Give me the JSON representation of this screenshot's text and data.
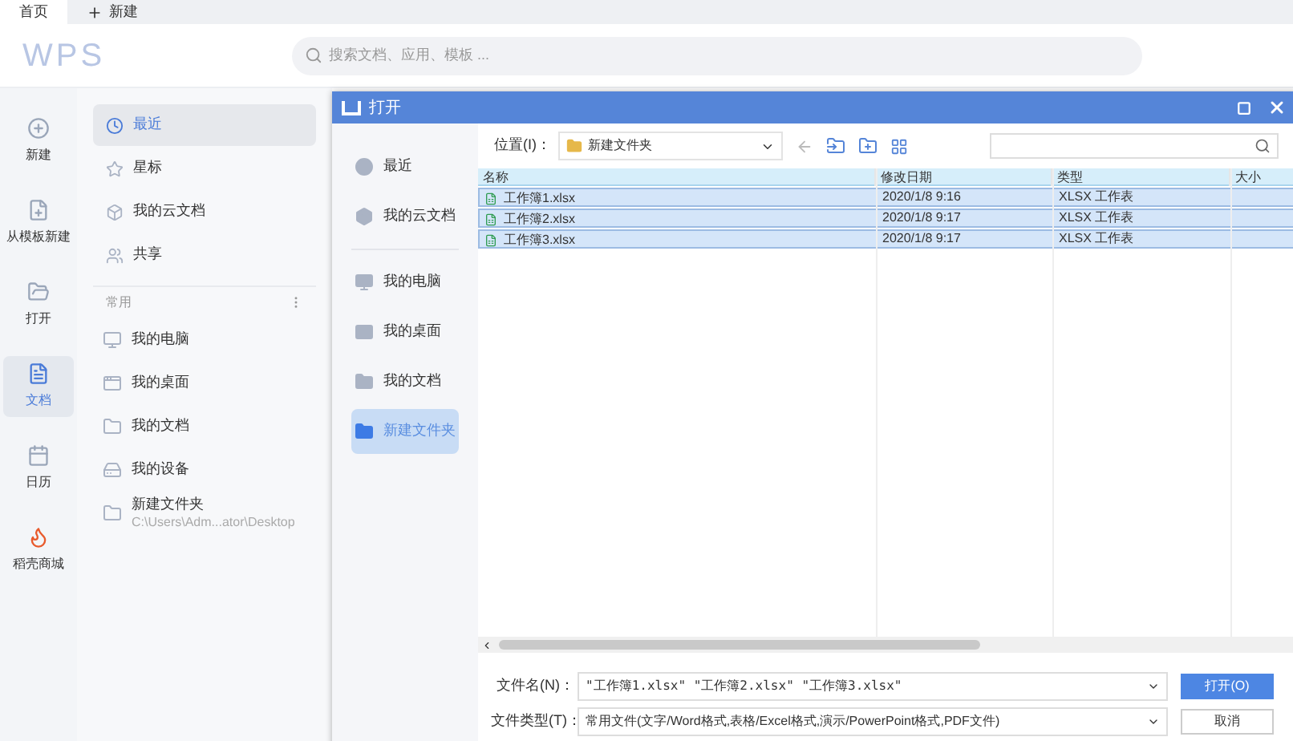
{
  "tabs": [
    {
      "label": "首页",
      "kind": "home",
      "selected": true
    },
    {
      "label": "新建",
      "kind": "new",
      "selected": false
    }
  ],
  "header": {
    "logo": "WPS",
    "search": {
      "placeholder": "搜索文档、应用、模板 ..."
    }
  },
  "rail": [
    {
      "label": "新建",
      "kind": "new",
      "selected": false
    },
    {
      "label": "从模板新建",
      "kind": "template",
      "selected": false
    },
    {
      "label": "打开",
      "kind": "open",
      "selected": false
    },
    {
      "label": "文档",
      "kind": "docs",
      "selected": true
    },
    {
      "label": "日历",
      "kind": "calendar",
      "selected": false
    },
    {
      "label": "稻壳商城",
      "kind": "store",
      "selected": false
    }
  ],
  "nav": {
    "items": [
      {
        "label": "最近",
        "kind": "recent",
        "selected": true
      },
      {
        "label": "星标",
        "kind": "star",
        "selected": false
      },
      {
        "label": "我的云文档",
        "kind": "cloud",
        "selected": false
      },
      {
        "label": "共享",
        "kind": "share",
        "selected": false
      }
    ],
    "section": "常用",
    "places": [
      {
        "label": "我的电脑",
        "kind": "pc"
      },
      {
        "label": "我的桌面",
        "kind": "desktop"
      },
      {
        "label": "我的文档",
        "kind": "folder"
      },
      {
        "label": "我的设备",
        "kind": "device"
      },
      {
        "label": "新建文件夹",
        "kind": "folder",
        "path": "C:\\Users\\Adm...ator\\Desktop"
      }
    ]
  },
  "dialog": {
    "title": "打开",
    "nav": [
      {
        "label": "最近",
        "kind": "recent",
        "selected": false
      },
      {
        "label": "我的云文档",
        "kind": "cloud",
        "selected": false
      },
      {
        "label": "我的电脑",
        "kind": "pc",
        "selected": false
      },
      {
        "label": "我的桌面",
        "kind": "desktop",
        "selected": false
      },
      {
        "label": "我的文档",
        "kind": "folder",
        "selected": false
      },
      {
        "label": "新建文件夹",
        "kind": "folder",
        "selected": true
      }
    ],
    "location_label": "位置(I)：",
    "location": "新建文件夹",
    "columns": [
      "名称",
      "修改日期",
      "类型",
      "大小"
    ],
    "rows": [
      {
        "name": "工作簿1.xlsx",
        "date": "2020/1/8 9:16",
        "type": "XLSX 工作表",
        "selected": true
      },
      {
        "name": "工作簿2.xlsx",
        "date": "2020/1/8 9:17",
        "type": "XLSX 工作表",
        "selected": true
      },
      {
        "name": "工作簿3.xlsx",
        "date": "2020/1/8 9:17",
        "type": "XLSX 工作表",
        "selected": true
      }
    ],
    "filename_label": "文件名(N)：",
    "filename": "\"工作簿1.xlsx\" \"工作簿2.xlsx\" \"工作簿3.xlsx\"",
    "filetype_label": "文件类型(T)：",
    "filetype": "常用文件(文字/Word格式,表格/Excel格式,演示/PowerPoint格式,PDF文件)",
    "buttons": [
      {
        "label": "打开(O)",
        "kind": "primary"
      },
      {
        "label": "取消",
        "kind": "secondary"
      }
    ]
  }
}
